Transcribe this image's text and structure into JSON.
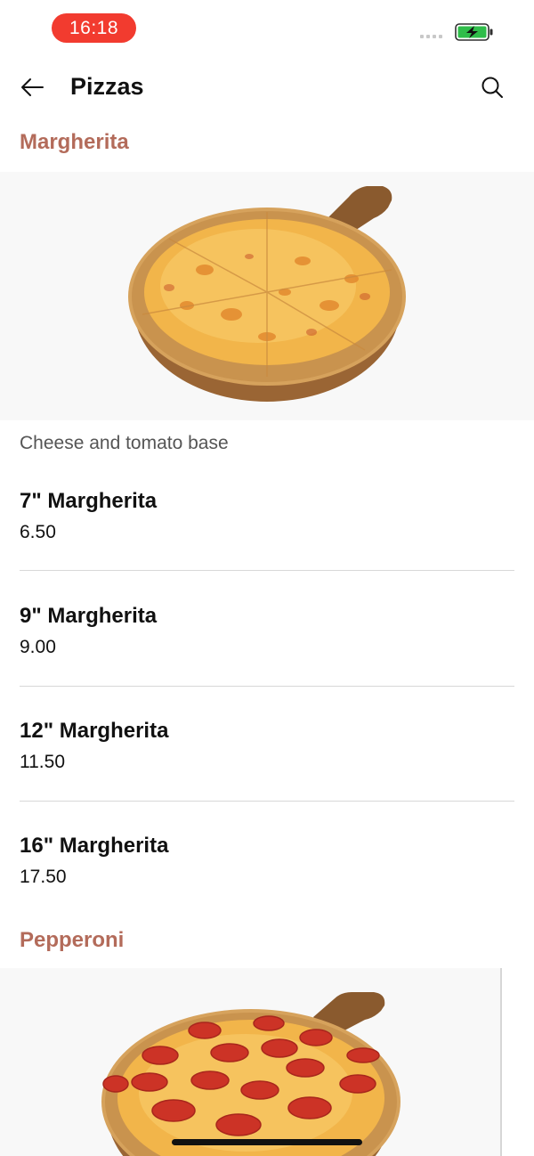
{
  "status_bar": {
    "time": "16:18",
    "battery": "charging"
  },
  "nav": {
    "title": "Pizzas",
    "back_icon": "arrow-left-icon",
    "search_icon": "search-icon"
  },
  "sections": [
    {
      "title": "Margherita",
      "description": "Cheese and tomato base",
      "items": [
        {
          "name": "7\" Margherita",
          "price": "6.50"
        },
        {
          "name": "9\" Margherita",
          "price": "9.00"
        },
        {
          "name": "12\" Margherita",
          "price": "11.50"
        },
        {
          "name": "16\" Margherita",
          "price": "17.50"
        }
      ]
    },
    {
      "title": "Pepperoni"
    }
  ],
  "colors": {
    "section_title": "#b36b5a",
    "time_pill": "#f23b2f",
    "battery_fill": "#2fbd4a"
  }
}
